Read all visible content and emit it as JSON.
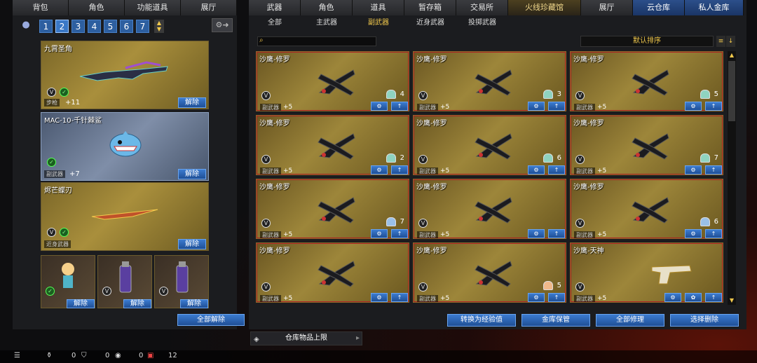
{
  "left": {
    "tabs": [
      "背包",
      "角色",
      "功能道具",
      "展厅"
    ],
    "pages": [
      "1",
      "2",
      "3",
      "4",
      "5",
      "6",
      "7"
    ],
    "selected_page": "2",
    "slots": [
      {
        "name": "九霄圣角",
        "category": "步枪",
        "level": "+11",
        "action": "解除"
      },
      {
        "name": "MAC-10-千针棘鲨",
        "category": "副武器",
        "level": "+7",
        "action": "解除"
      },
      {
        "name": "烬芒蝶刃",
        "category": "近身武器",
        "level": "",
        "action": "解除"
      }
    ],
    "small_slots": [
      {
        "action": "解除"
      },
      {
        "action": "解除"
      },
      {
        "action": "解除"
      }
    ],
    "remove_all": "全部解除"
  },
  "right": {
    "tabs": [
      "武器",
      "角色",
      "道具",
      "暂存箱",
      "交易所",
      "火线珍藏馆",
      "展厅",
      "云仓库",
      "私人金库"
    ],
    "subtabs": [
      "全部",
      "主武器",
      "副武器",
      "近身武器",
      "投掷武器"
    ],
    "active_subtab": "副武器",
    "sort_label": "默认排序",
    "cards": [
      {
        "name": "沙鹰-修罗",
        "category": "副武器",
        "level": "+5",
        "count": "4",
        "icon_color": "green"
      },
      {
        "name": "沙鹰-修罗",
        "category": "副武器",
        "level": "+5",
        "count": "3",
        "icon_color": "green"
      },
      {
        "name": "沙鹰-修罗",
        "category": "副武器",
        "level": "+5",
        "count": "5",
        "icon_color": "green"
      },
      {
        "name": "沙鹰-修罗",
        "category": "副武器",
        "level": "+5",
        "count": "2",
        "icon_color": "green"
      },
      {
        "name": "沙鹰-修罗",
        "category": "副武器",
        "level": "+5",
        "count": "6",
        "icon_color": "green"
      },
      {
        "name": "沙鹰-修罗",
        "category": "副武器",
        "level": "+5",
        "count": "7",
        "icon_color": "green"
      },
      {
        "name": "沙鹰-修罗",
        "category": "副武器",
        "level": "+5",
        "count": "7",
        "icon_color": "blue"
      },
      {
        "name": "沙鹰-修罗",
        "category": "副武器",
        "level": "+5",
        "count": "",
        "icon_color": "none"
      },
      {
        "name": "沙鹰-修罗",
        "category": "副武器",
        "level": "+5",
        "count": "6",
        "icon_color": "blue"
      },
      {
        "name": "沙鹰-修罗",
        "category": "副武器",
        "level": "+5",
        "count": "",
        "icon_color": "none"
      },
      {
        "name": "沙鹰-修罗",
        "category": "副武器",
        "level": "+5",
        "count": "5",
        "icon_color": "peach"
      },
      {
        "name": "沙鹰-天神",
        "category": "副武器",
        "level": "+5",
        "count": "",
        "icon_color": "none"
      }
    ],
    "actions": [
      "转换为经验值",
      "金库保管",
      "全部修理",
      "选择删除"
    ],
    "capacity_label": "仓库物品上限"
  },
  "bottombar": {
    "a": "0",
    "b": "0",
    "c": "0",
    "d": "12"
  }
}
